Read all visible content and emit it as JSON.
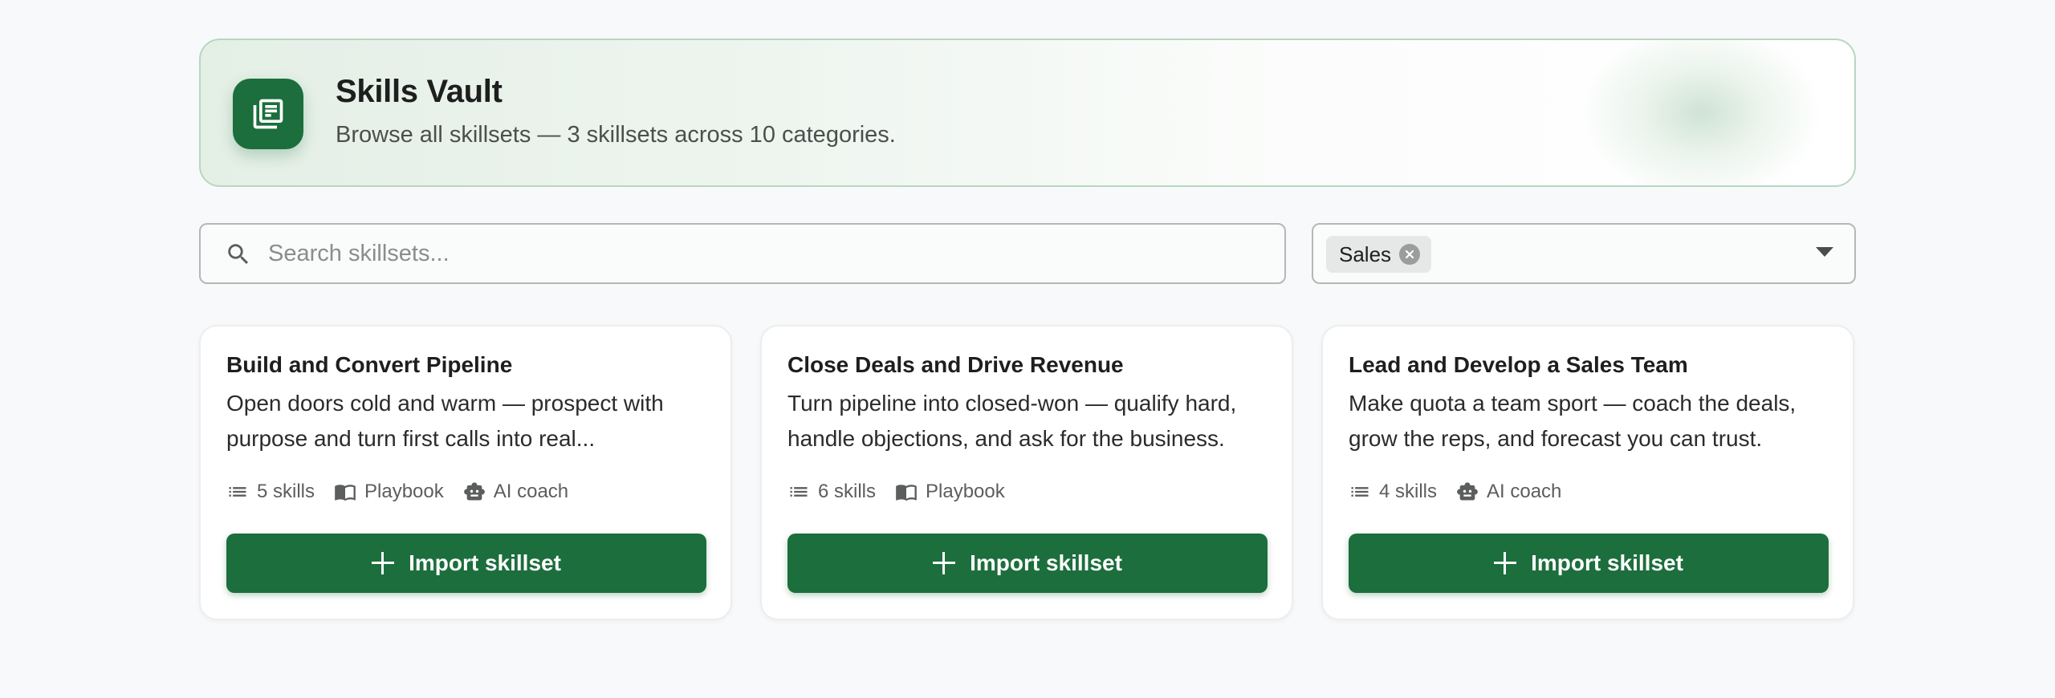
{
  "header": {
    "title": "Skills Vault",
    "subtitle": "Browse all skillsets — 3 skillsets across 10 categories.",
    "icon": "library-books-icon",
    "accent_color": "#1c6e3d"
  },
  "search": {
    "placeholder": "Search skillsets...",
    "value": ""
  },
  "category_filter": {
    "selected": "Sales"
  },
  "cards": [
    {
      "title": "Build and Convert Pipeline",
      "description": "Open doors cold and warm — prospect with purpose and turn first calls into real...",
      "skills": "5 skills",
      "playbook": "Playbook",
      "ai_coach": "AI coach",
      "button": "Import skillset"
    },
    {
      "title": "Close Deals and Drive Revenue",
      "description": "Turn pipeline into closed-won — qualify hard, handle objections, and ask for the business.",
      "skills": "6 skills",
      "playbook": "Playbook",
      "button": "Import skillset"
    },
    {
      "title": "Lead and Develop a Sales Team",
      "description": "Make quota a team sport — coach the deals, grow the reps, and forecast you can trust.",
      "skills": "4 skills",
      "ai_coach": "AI coach",
      "button": "Import skillset"
    }
  ]
}
